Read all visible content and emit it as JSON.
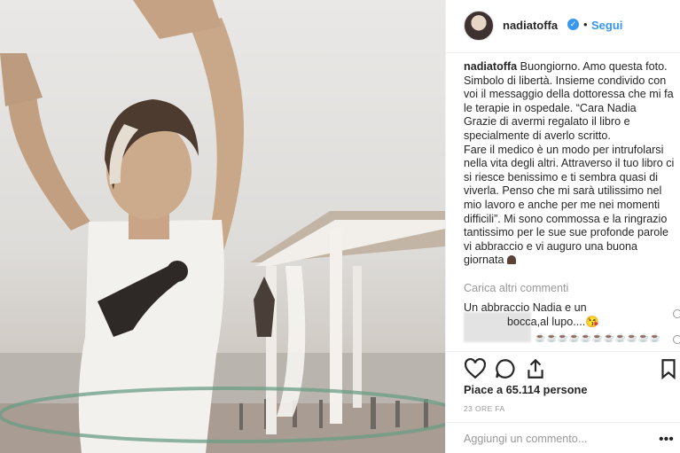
{
  "post": {
    "username": "nadiatoffa",
    "follow_label": "Segui",
    "header_separator": "•",
    "caption_text": "Buongiorno. Amo questa foto.\nSimbolo di libertà. Insieme condivido con\nvoi il messaggio della dottoressa che mi fa\nle terapie in ospedale. “Cara Nadia\nGrazie di avermi regalato il libro e\nspecialmente di averlo scritto.\nFare il medico è un modo per intrufolarsi\nnella vita degli altri. Attraverso il tuo libro ci\nsi riesce benissimo e ti sembra quasi di\nviverla. Penso che mi sarà utilissimo nel\nmio lavoro e anche per me nei momenti\ndifficili”. Mi sono commossa e la ringrazio\ntantissimo per le sue sue profonde parole\nvi abbraccio e vi auguro una buona\ngiornata",
    "caption_emoji": "pray-hands-icon",
    "load_more_label": "Carica altri commenti",
    "comments": [
      {
        "text": "Un abbraccio Nadia e un\n              bocca,al lupo....😘"
      },
      {
        "text": "☕☕☕☕☕☕☕☕☕☕☕"
      }
    ],
    "likes_label": "Piace a 65.114 persone",
    "time_label": "23 ORE FA",
    "add_comment_placeholder": "Aggiungi un commento...",
    "more_options": "•••"
  },
  "colors": {
    "accent": "#3897f0",
    "secondary_text": "#999999",
    "primary_text": "#262626"
  }
}
